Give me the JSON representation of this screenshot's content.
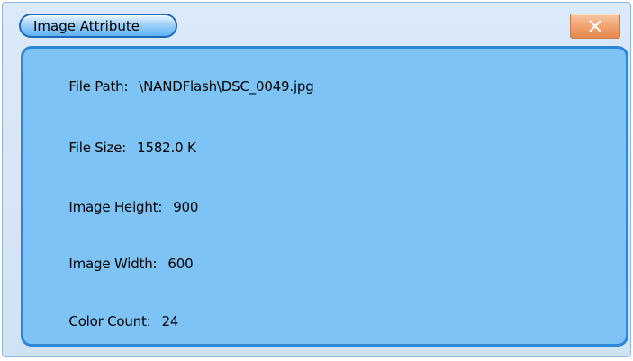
{
  "dialog": {
    "title": "Image Attribute",
    "close_icon": "close-icon"
  },
  "attributes": [
    {
      "label": "File Path:",
      "value": "\\NANDFlash\\DSC_0049.jpg"
    },
    {
      "label": "File Size:",
      "value": "1582.0 K"
    },
    {
      "label": "Image Height:",
      "value": "900"
    },
    {
      "label": "Image Width:",
      "value": "600"
    },
    {
      "label": "Color Count:",
      "value": "24"
    }
  ],
  "colors": {
    "panel": "#7ec3f6",
    "panel_border": "#2e86d6",
    "close_button": "#f0a06c"
  }
}
